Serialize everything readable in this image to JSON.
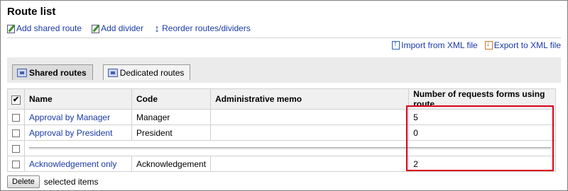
{
  "title": "Route list",
  "actions": [
    {
      "label": "Add shared route",
      "icon": "edit-icon"
    },
    {
      "label": "Add divider",
      "icon": "edit-icon"
    },
    {
      "label": "Reorder routes/dividers",
      "icon": "up-down-arrow-icon"
    }
  ],
  "file_actions": [
    {
      "label": "Import from XML file",
      "icon": "import-icon"
    },
    {
      "label": "Export to XML file",
      "icon": "export-icon"
    }
  ],
  "tabs": [
    {
      "label": "Shared routes",
      "active": true
    },
    {
      "label": "Dedicated routes",
      "active": false
    }
  ],
  "table": {
    "headers": [
      "Name",
      "Code",
      "Administrative memo",
      "Number of requests forms using route"
    ],
    "header_check": "✔",
    "rows": [
      {
        "type": "route",
        "name": "Approval by Manager",
        "code": "Manager",
        "memo": "",
        "count": "5"
      },
      {
        "type": "route",
        "name": "Approval by President",
        "code": "President",
        "memo": "",
        "count": "0"
      },
      {
        "type": "divider"
      },
      {
        "type": "route",
        "name": "Acknowledgement only",
        "code": "Acknowledgement",
        "memo": "",
        "count": "2"
      }
    ]
  },
  "bottom": {
    "delete_label": "Delete",
    "selected_label": "selected items"
  },
  "colors": {
    "link": "#1a3aa8",
    "highlight": "#d9001b",
    "header_bg": "#f0f0f0"
  }
}
